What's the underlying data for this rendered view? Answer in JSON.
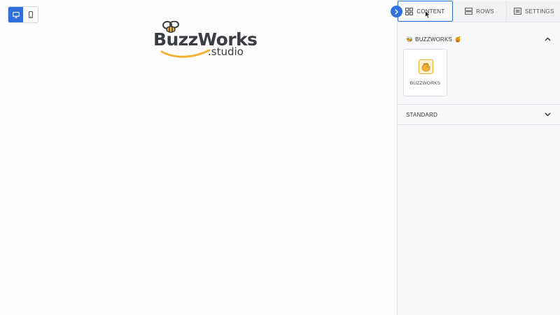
{
  "brand": {
    "logo_main": "BuzzWorks",
    "logo_sub": ".studio",
    "accent": "#2f6fdc",
    "honey": "#f2b233"
  },
  "toolbar": {
    "desktop_icon": "desktop-icon",
    "mobile_icon": "mobile-icon"
  },
  "panel": {
    "tabs": [
      {
        "label": "CONTENT",
        "icon": "grid-icon",
        "active": true
      },
      {
        "label": "ROWS",
        "icon": "rows-icon",
        "active": false
      },
      {
        "label": "SETTINGS",
        "icon": "settings-list-icon",
        "active": false
      }
    ],
    "sections": [
      {
        "title": "BUZZWORKS",
        "prefix_emoji": "🐝",
        "suffix_emoji": "🍯",
        "expanded": true,
        "items": [
          {
            "label": "BUZZWORKS",
            "icon": "honey-pot-icon"
          }
        ]
      },
      {
        "title": "STANDARD",
        "expanded": false
      }
    ]
  }
}
